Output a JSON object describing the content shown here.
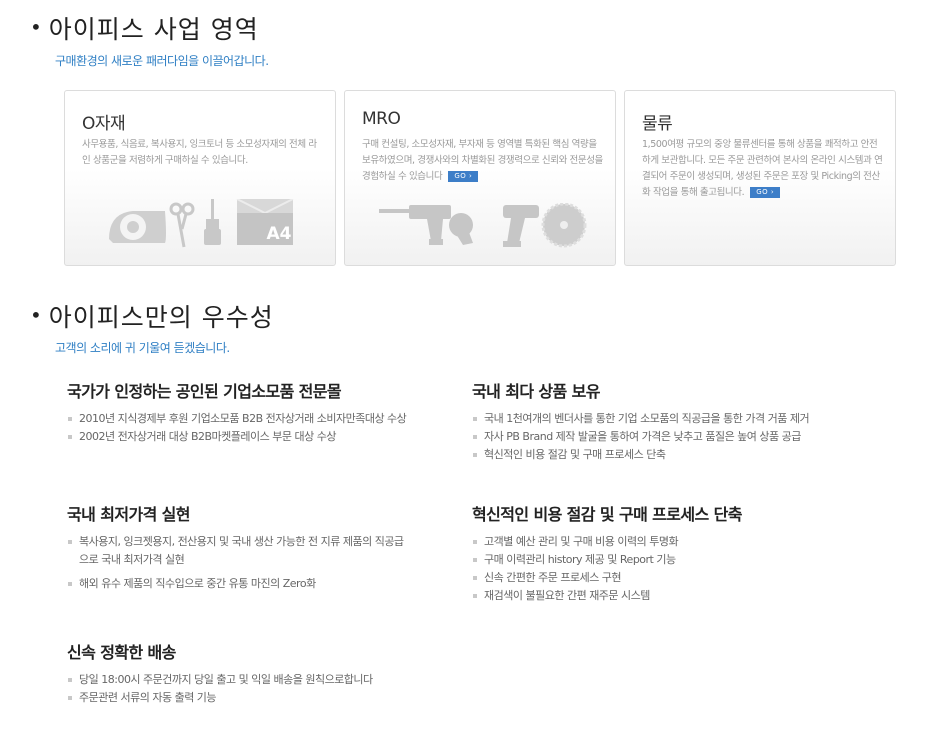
{
  "business": {
    "title": "아이피스 사업 영역",
    "subtitle": "구매환경의 새로운 패러다임을 이끌어갑니다.",
    "cards": [
      {
        "title": "O자재",
        "desc": "사무용품, 식음료, 복사용지, 잉크토너 등 소모성자재의 전체 라인 상품군을 저렴하게 구매하실 수 있습니다.",
        "go": ""
      },
      {
        "title": "MRO",
        "desc": "구매 컨설팅, 소모성자재, 부자재 등 영역별 특화된 핵심 역량을 보유하였으며, 경쟁사와의 차별화된 경쟁력으로 신뢰와 전문성을 경험하실 수 있습니다",
        "go": "GO ›"
      },
      {
        "title": "물류",
        "desc": "1,500여평 규모의 중앙 물류센터를 통해 상품을 쾌적하고 안전하게 보관합니다. 모든 주문 관련하여 본사의 온라인 시스템과 연결되어 주문이 생성되며, 생성된 주문은 포장 및 Picking의 전산화 작업을 통해 출고됩니다.",
        "go": "GO ›"
      }
    ],
    "a4_label": "A4"
  },
  "excellence": {
    "title": "아이피스만의 우수성",
    "subtitle": "고객의 소리에 귀 기울여 듣겠습니다.",
    "features": [
      {
        "title": "국가가 인정하는 공인된 기업소모품 전문몰",
        "items": [
          "2010년 지식경제부 후원 기업소모품 B2B 전자상거래 소비자만족대상 수상",
          "2002년 전자상거래 대상 B2B마켓플레이스 부문 대상 수상"
        ]
      },
      {
        "title": "국내 최다 상품 보유",
        "items": [
          "국내 1천여개의 벤더사를 통한 기업 소모품의 직공급을 통한 가격 거품 제거",
          "자사 PB Brand 제작 발굴을 통하여 가격은 낮추고 품질은 높여 상품 공급",
          "혁신적인 비용 절감 및 구매 프로세스 단축"
        ]
      },
      {
        "title": "국내 최저가격 실현",
        "items": [
          "복사용지, 잉크젯용지, 전산용지 및 국내 생산 가능한 전 지류 제품의 직공급으로 국내 최저가격 실현",
          "해외 유수 제품의 직수입으로 중간 유통 마진의 Zero화"
        ]
      },
      {
        "title": "혁신적인 비용 절감 및 구매 프로세스 단축",
        "items": [
          "고객별 예산 관리 및 구매 비용 이력의 투명화",
          "구매 이력관리 history 제공 및 Report 기능",
          "신속 간편한 주문 프로세스 구현",
          "재검색이 불필요한 간편 재주문 시스템"
        ]
      },
      {
        "title": "신속 정확한 배송",
        "items": [
          "당일 18:00시 주문건까지 당일 출고 및 익일 배송을 원칙으로합니다",
          "주문관련 서류의 자동 출력 기능"
        ]
      }
    ]
  }
}
